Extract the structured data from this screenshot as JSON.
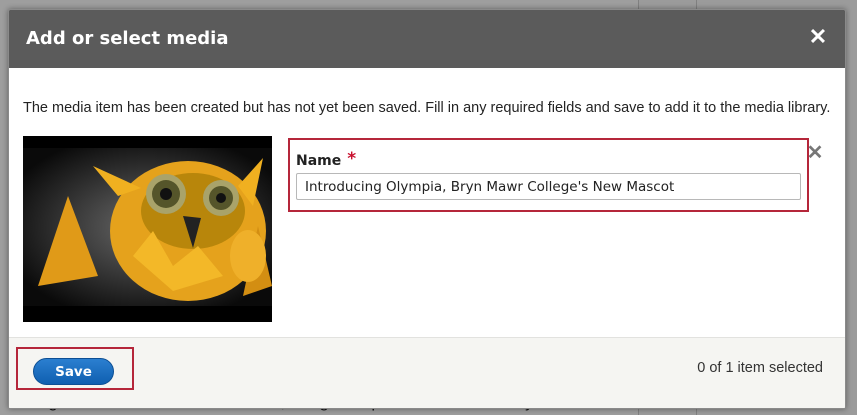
{
  "dialog": {
    "title": "Add or select media",
    "close_icon": "close-icon",
    "message": "The media item has been created but has not yet been saved. Fill in any required fields and save to add it to the media library.",
    "thumbnail_icon": "video-thumbnail-owl-mascot",
    "name_field": {
      "label": "Name",
      "required_mark": "*",
      "value": "Introducing Olympia, Bryn Mawr College's New Mascot"
    },
    "remove_icon": "remove-x-icon",
    "footer": {
      "save_label": "Save",
      "status": "0 of 1 item selected"
    }
  },
  "background": {
    "bottom_text": "assign headers to rows or columns, merge or split cells.  The action you"
  },
  "colors": {
    "titlebar": "#5b5b5b",
    "highlight": "#b5263a",
    "save_button": "#1b6fc1",
    "required": "#c8102e"
  }
}
